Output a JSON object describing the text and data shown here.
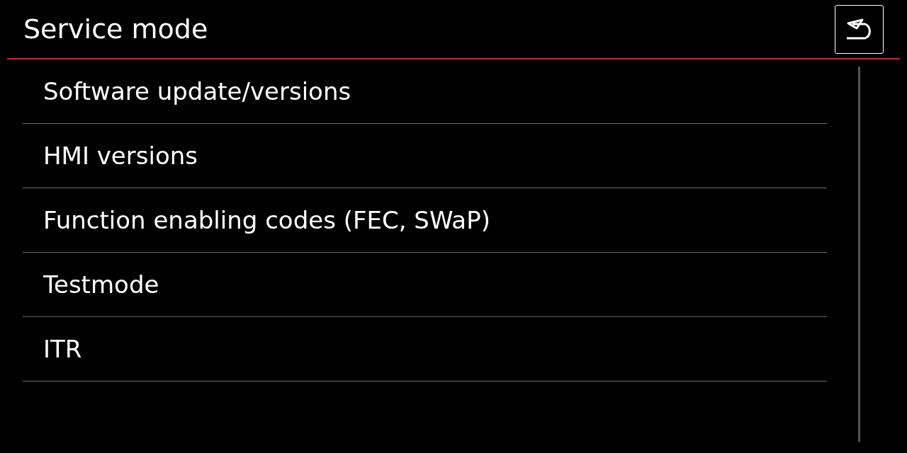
{
  "header": {
    "title": "Service mode"
  },
  "menu": {
    "items": [
      {
        "label": "Software update/versions"
      },
      {
        "label": "HMI versions"
      },
      {
        "label": "Function enabling codes (FEC, SWaP)"
      },
      {
        "label": "Testmode"
      },
      {
        "label": "ITR"
      }
    ]
  }
}
